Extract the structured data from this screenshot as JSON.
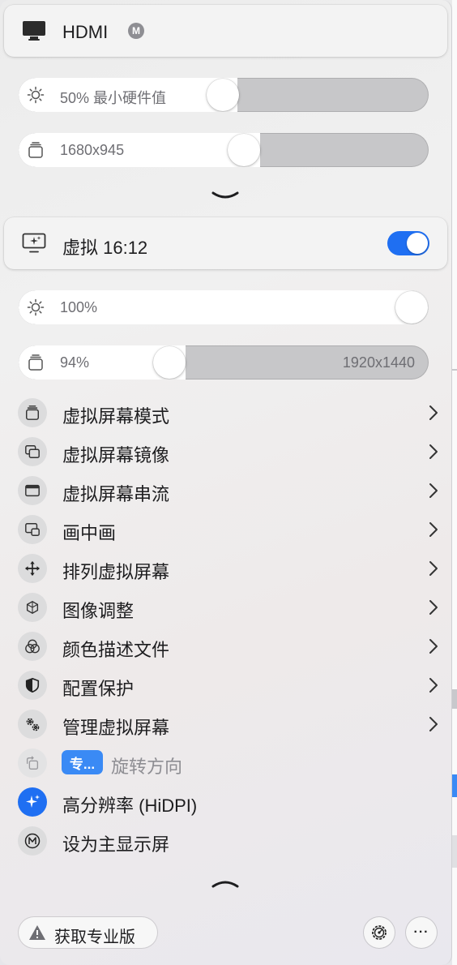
{
  "header_display": {
    "title": "HDMI",
    "badge": "M",
    "icon": "monitor-icon"
  },
  "brightness_slider": {
    "label": "50% 最小硬件值",
    "value_percent": 50,
    "icon": "sun-icon"
  },
  "resolution_slider": {
    "label": "1680x945",
    "icon": "stack-icon"
  },
  "virtual_display": {
    "title": "虚拟 16:12",
    "enabled": true,
    "icon": "virtual-display-icon",
    "accent_color": "#1f6ff2"
  },
  "virtual_brightness_slider": {
    "label": "100%",
    "value_percent": 100,
    "icon": "sun-icon"
  },
  "virtual_scale_slider": {
    "label": "94%",
    "right_label": "1920x1440",
    "icon": "stack-icon"
  },
  "menu": {
    "items": [
      {
        "label": "虚拟屏幕模式",
        "icon": "stack-icon"
      },
      {
        "label": "虚拟屏幕镜像",
        "icon": "mirror-icon"
      },
      {
        "label": "虚拟屏幕串流",
        "icon": "stream-window-icon"
      },
      {
        "label": "画中画",
        "icon": "pip-icon"
      },
      {
        "label": "排列虚拟屏幕",
        "icon": "move-arrows-icon"
      },
      {
        "label": "图像调整",
        "icon": "cube-icon"
      },
      {
        "label": "颜色描述文件",
        "icon": "color-circles-icon"
      },
      {
        "label": "配置保护",
        "icon": "shield-icon"
      },
      {
        "label": "管理虚拟屏幕",
        "icon": "gears-icon"
      }
    ],
    "rotate": {
      "pro_badge": "专...",
      "label": "旋转方向",
      "icon": "rotate-icon"
    },
    "hidpi": {
      "label": "高分辨率 (HiDPI)",
      "icon": "sparkle-icon"
    },
    "set_main": {
      "label": "设为主显示屏",
      "icon": "m-circle-icon"
    }
  },
  "footer": {
    "get_pro_label": "获取专业版",
    "get_pro_icon": "warning-icon",
    "settings_icon": "gear-icon",
    "more_label": "···"
  }
}
